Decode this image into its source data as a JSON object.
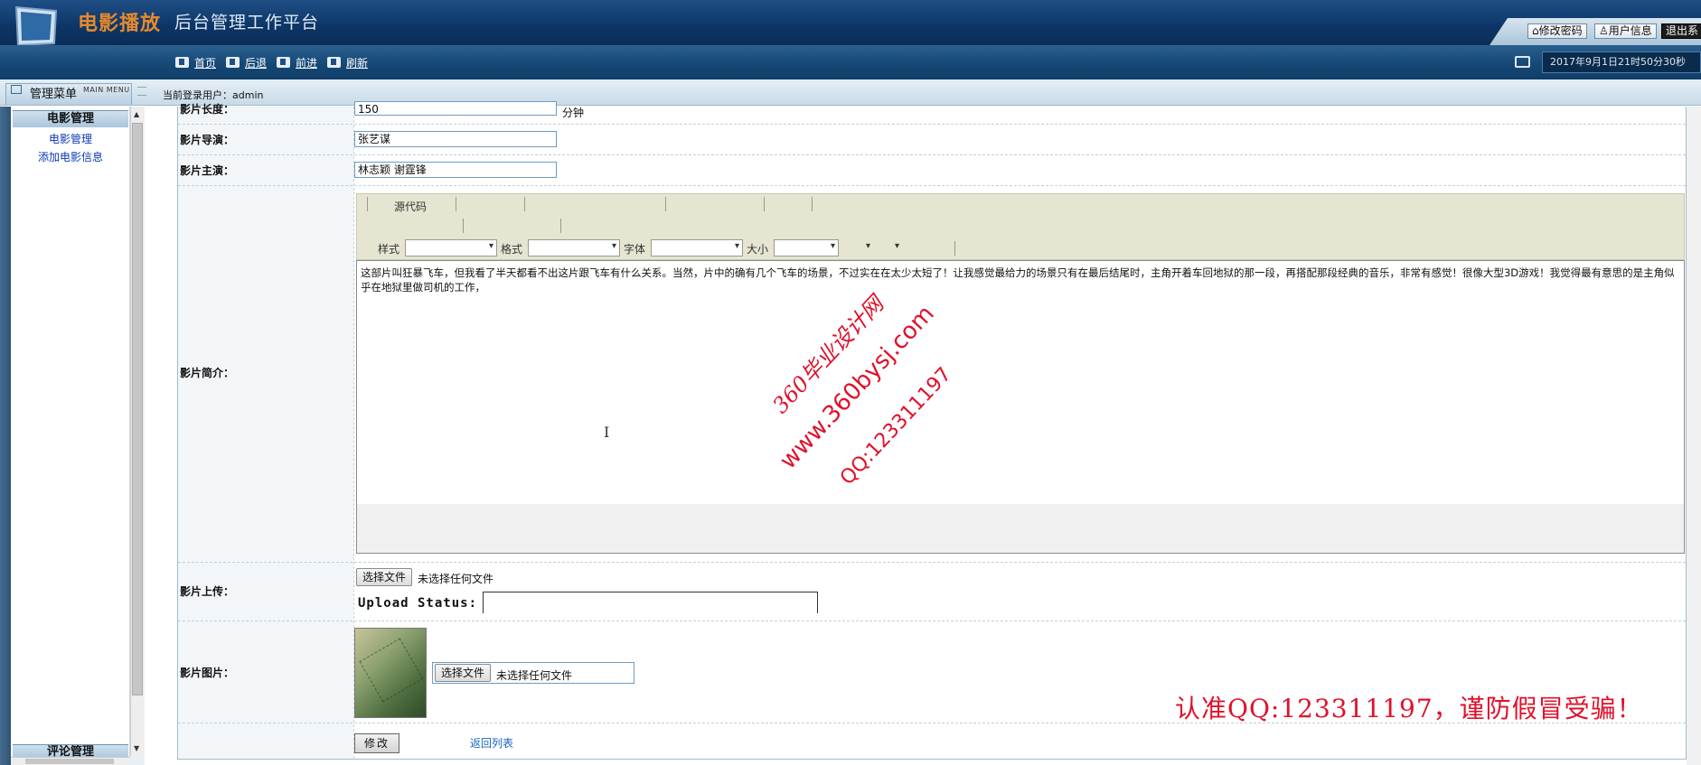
{
  "header": {
    "brand_title": "电影播放",
    "brand_subtitle": "后台管理工作平台",
    "buttons": {
      "change_password": "修改密码",
      "user_info": "用户信息",
      "logout": "退出系"
    }
  },
  "navbar": {
    "home": "首页",
    "back": "后退",
    "forward": "前进",
    "refresh": "刷新",
    "datetime": "2017年9月1日21时50分30秒"
  },
  "menubar": {
    "title": "管理菜单",
    "subtitle": "MAIN MENU",
    "current_user": "当前登录用户：admin"
  },
  "sidebar": {
    "section": "电影管理",
    "items": [
      {
        "label": "电影管理"
      },
      {
        "label": "添加电影信息"
      }
    ],
    "footer_section": "评论管理"
  },
  "form": {
    "length_label": "影片长度：",
    "length_value": "150",
    "length_unit": "分钟",
    "director_label": "影片导演：",
    "director_value": "张艺谋",
    "actors_label": "影片主演：",
    "actors_value": "林志颖 谢霆锋",
    "intro_label": "影片简介：",
    "upload_label": "影片上传：",
    "image_label": "影片图片：",
    "choose_file": "选择文件",
    "no_file": "未选择任何文件",
    "upload_status": "Upload Status:",
    "submit": "修改",
    "back_to_list": "返回列表"
  },
  "editor": {
    "source_code": "源代码",
    "style_label": "样式",
    "format_label": "格式",
    "font_label": "字体",
    "size_label": "大小",
    "content": "这部片叫狂暴飞车，但我看了半天都看不出这片跟飞车有什么关系。当然，片中的确有几个飞车的场景，不过实在在太少太短了！让我感觉最给力的场景只有在最后结尾时，主角开着车回地狱的那一段，再搭配那段经典的音乐，非常有感觉！很像大型3D游戏！我觉得最有意思的是主角似乎在地狱里做司机的工作，"
  },
  "watermark": {
    "line1": "360毕业设计网",
    "line2": "www.360bysj.com",
    "line3": "QQ:123311197",
    "warning": "认准QQ:123311197，谨防假冒受骗！"
  },
  "colors": {
    "header_bg": "#0c3566",
    "brand_orange": "#e58a2d",
    "watermark_red": "#e0112b",
    "link_blue": "#0b39b5"
  }
}
